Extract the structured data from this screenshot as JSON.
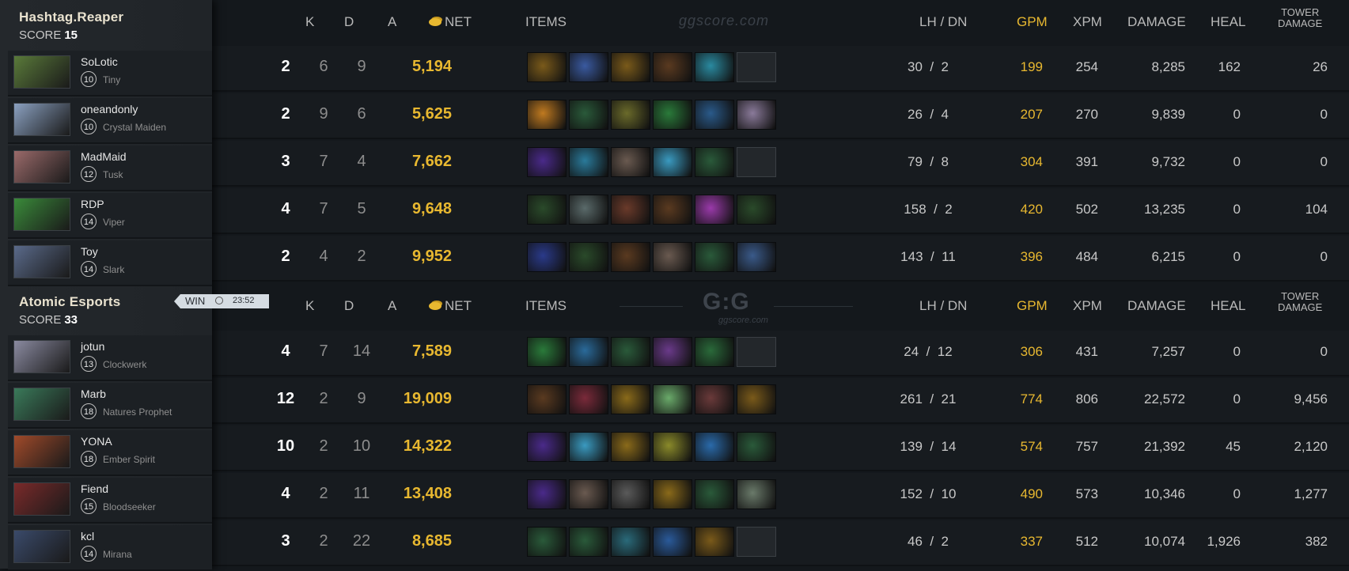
{
  "columns": {
    "k": "K",
    "d": "D",
    "a": "A",
    "net": "NET",
    "items": "ITEMS",
    "lhdn": "LH  /  DN",
    "gpm": "GPM",
    "xpm": "XPM",
    "damage": "DAMAGE",
    "heal": "HEAL",
    "tower1": "TOWER",
    "tower2": "DAMAGE"
  },
  "watermark": "ggscore.com",
  "logo": {
    "mark": "G:G",
    "sub": "ggscore.com"
  },
  "teams": [
    {
      "name": "Hashtag.Reaper",
      "score_label": "SCORE",
      "score": "15",
      "players": [
        {
          "name": "SoLotic",
          "level": "10",
          "hero": "Tiny",
          "k": "2",
          "d": "6",
          "a": "9",
          "net": "5,194",
          "lhdn": "30  /  2",
          "gpm": "199",
          "xpm": "254",
          "damage": "8,285",
          "heal": "162",
          "tower": "26",
          "items": [
            "#7a5a1a",
            "#3a5aa0",
            "#7a5a1a",
            "#5a3a20",
            "#2a8aa0",
            ""
          ]
        },
        {
          "name": "oneandonly",
          "level": "10",
          "hero": "Crystal Maiden",
          "k": "2",
          "d": "9",
          "a": "6",
          "net": "5,625",
          "lhdn": "26  /  4",
          "gpm": "207",
          "xpm": "270",
          "damage": "9,839",
          "heal": "0",
          "tower": "0",
          "items": [
            "#c07a20",
            "#2a5a3a",
            "#6a6a2a",
            "#2a7a3a",
            "#2a5a8a",
            "#8a7a9a"
          ]
        },
        {
          "name": "MadMaid",
          "level": "12",
          "hero": "Tusk",
          "k": "3",
          "d": "7",
          "a": "4",
          "net": "7,662",
          "lhdn": "79  /  8",
          "gpm": "304",
          "xpm": "391",
          "damage": "9,732",
          "heal": "0",
          "tower": "0",
          "items": [
            "#4a2a8a",
            "#2a7a9a",
            "#6a5a50",
            "#3a9ac0",
            "#2a5a3a",
            ""
          ]
        },
        {
          "name": "RDP",
          "level": "14",
          "hero": "Viper",
          "k": "4",
          "d": "7",
          "a": "5",
          "net": "9,648",
          "lhdn": "158  /  2",
          "gpm": "420",
          "xpm": "502",
          "damage": "13,235",
          "heal": "0",
          "tower": "104",
          "items": [
            "#2a4a2a",
            "#5a6a6a",
            "#6a3a2a",
            "#5a3a20",
            "#9a3aaa",
            "#2a4a2a"
          ]
        },
        {
          "name": "Toy",
          "level": "14",
          "hero": "Slark",
          "k": "2",
          "d": "4",
          "a": "2",
          "net": "9,952",
          "lhdn": "143  /  11",
          "gpm": "396",
          "xpm": "484",
          "damage": "6,215",
          "heal": "0",
          "tower": "0",
          "items": [
            "#2a3a8a",
            "#2a4a2a",
            "#5a3a20",
            "#6a5a50",
            "#2a5a3a",
            "#3a5a8a"
          ]
        }
      ]
    },
    {
      "name": "Atomic Esports",
      "score_label": "SCORE",
      "score": "33",
      "win": "WIN",
      "time": "23:52",
      "players": [
        {
          "name": "jotun",
          "level": "13",
          "hero": "Clockwerk",
          "k": "4",
          "d": "7",
          "a": "14",
          "net": "7,589",
          "lhdn": "24  /  12",
          "gpm": "306",
          "xpm": "431",
          "damage": "7,257",
          "heal": "0",
          "tower": "0",
          "items": [
            "#2a7a3a",
            "#2a6a9a",
            "#2a5a3a",
            "#6a3a8a",
            "#2a6a3a",
            ""
          ]
        },
        {
          "name": "Marb",
          "level": "18",
          "hero": "Natures Prophet",
          "k": "12",
          "d": "2",
          "a": "9",
          "net": "19,009",
          "lhdn": "261  /  21",
          "gpm": "774",
          "xpm": "806",
          "damage": "22,572",
          "heal": "0",
          "tower": "9,456",
          "items": [
            "#5a3a20",
            "#7a2a3a",
            "#8a6a1a",
            "#6aaa6a",
            "#6a3a3a",
            "#7a5a1a"
          ]
        },
        {
          "name": "YONA",
          "level": "18",
          "hero": "Ember Spirit",
          "k": "10",
          "d": "2",
          "a": "10",
          "net": "14,322",
          "lhdn": "139  /  14",
          "gpm": "574",
          "xpm": "757",
          "damage": "21,392",
          "heal": "45",
          "tower": "2,120",
          "items": [
            "#4a2a8a",
            "#3a9ac0",
            "#8a6a1a",
            "#8a8a2a",
            "#2a6aaa",
            "#2a5a3a"
          ]
        },
        {
          "name": "Fiend",
          "level": "15",
          "hero": "Bloodseeker",
          "k": "4",
          "d": "2",
          "a": "11",
          "net": "13,408",
          "lhdn": "152  /  10",
          "gpm": "490",
          "xpm": "573",
          "damage": "10,346",
          "heal": "0",
          "tower": "1,277",
          "items": [
            "#4a2a8a",
            "#6a5a50",
            "#5a5a5a",
            "#8a6a1a",
            "#2a5a3a",
            "#6a7a6a"
          ]
        },
        {
          "name": "kcl",
          "level": "14",
          "hero": "Mirana",
          "k": "3",
          "d": "2",
          "a": "22",
          "net": "8,685",
          "lhdn": "46  /  2",
          "gpm": "337",
          "xpm": "512",
          "damage": "10,074",
          "heal": "1,926",
          "tower": "382",
          "items": [
            "#2a5a3a",
            "#2a5a3a",
            "#2a6a7a",
            "#2a5a9a",
            "#7a5a1a",
            ""
          ]
        }
      ]
    }
  ],
  "portrait_colors": [
    "#5a7a3a",
    "#8aa0c0",
    "#9a6a6a",
    "#3a8a3a",
    "#5a6a8a",
    "#8a8aa0",
    "#3a7a5a",
    "#a04a2a",
    "#7a2a2a",
    "#3a4a6a"
  ]
}
